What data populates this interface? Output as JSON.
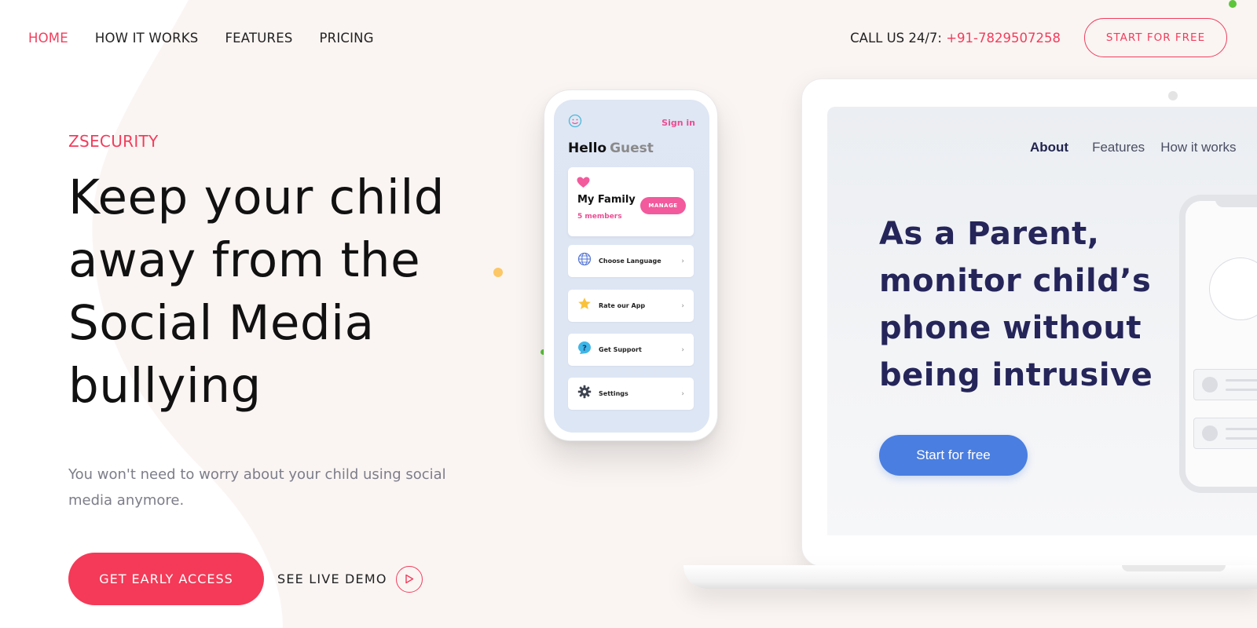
{
  "nav": {
    "links": [
      {
        "label": "HOME",
        "active": true
      },
      {
        "label": "HOW IT WORKS",
        "active": false
      },
      {
        "label": "FEATURES",
        "active": false
      },
      {
        "label": "PRICING",
        "active": false
      }
    ],
    "call_prefix": "CALL US 24/7: ",
    "phone": "+91-7829507258",
    "start_button": "START FOR FREE"
  },
  "hero": {
    "brand": "ZSECURITY",
    "headline_lines": [
      "Keep your child",
      "away from the",
      "Social Media",
      "bullying"
    ],
    "subtitle": "You won't need to worry about your child using social media anymore.",
    "cta_primary": "GET EARLY ACCESS",
    "cta_demo": "SEE LIVE DEMO"
  },
  "phone_mockup": {
    "sign_in": "Sign in",
    "hello": "Hello",
    "guest": "Guest",
    "family_title": "My Family",
    "family_members": "5 members",
    "manage_button": "MANAGE",
    "menu_items": [
      {
        "label": "Choose Language",
        "icon": "globe-icon"
      },
      {
        "label": "Rate our App",
        "icon": "star-icon"
      },
      {
        "label": "Get Support",
        "icon": "help-bubble-icon"
      },
      {
        "label": "Settings",
        "icon": "gear-icon"
      }
    ],
    "chevron": "›"
  },
  "laptop_mockup": {
    "nav": [
      "About",
      "Features",
      "How it works"
    ],
    "headline": "As a Parent, monitor child’s phone without being intrusive",
    "button": "Start for free"
  },
  "colors": {
    "accent": "#f23d5c",
    "laptop_button": "#4a7ee0",
    "laptop_headline": "#25255a",
    "phone_pink": "#ec4d93",
    "blob": "#faf5f3"
  }
}
